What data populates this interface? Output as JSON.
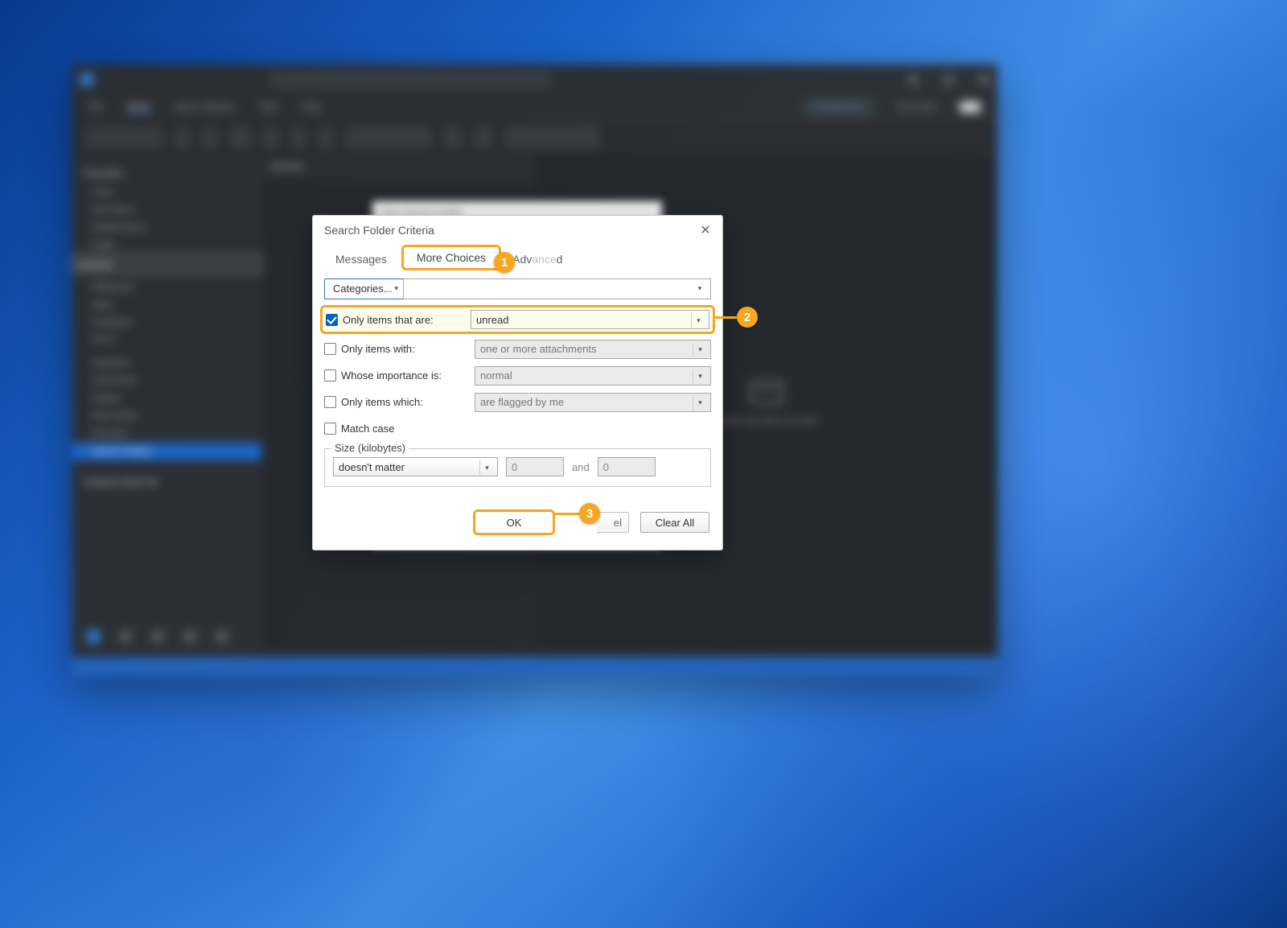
{
  "bg_app": {
    "search_placeholder": "Search",
    "ribbon_tabs": [
      "File",
      "Home",
      "Send / Receive",
      "View",
      "Help"
    ],
    "active_ribbon_tab": "Home",
    "coming_soon": "Coming Soon",
    "try_it_now": "Try it now",
    "new_email": "New Email",
    "unread_read": "Unread/ Read",
    "search_people": "Search People",
    "favorites": "Favorites",
    "fav_items": [
      "Inbox",
      "Sent Items",
      "Deleted Items",
      "Drafts",
      "Archive"
    ],
    "inbox_folders": [
      "AliExpress",
      "eBay",
      "Facebook",
      "IFTTT"
    ],
    "more_folders": [
      "Important",
      "Junk Email",
      "Outbox",
      "RSS Feeds",
      "Snoozed",
      "Search Folders"
    ],
    "data_file": "Outlook Data File",
    "list_header": "Archive",
    "reading_prompt": "Select an item to read",
    "under_dialog_title": "New Search Folder"
  },
  "dialog": {
    "title": "Search Folder Criteria",
    "tabs": {
      "messages": "Messages",
      "more_choices": "More Choices",
      "advanced": "Advanced"
    },
    "categories_btn": "Categories...",
    "rows": {
      "items_that_are": {
        "label": "Only items that are:",
        "checked": true,
        "value": "unread"
      },
      "items_with": {
        "label": "Only items with:",
        "checked": false,
        "value": "one or more attachments"
      },
      "importance": {
        "label": "Whose importance is:",
        "checked": false,
        "value": "normal"
      },
      "items_which": {
        "label": "Only items which:",
        "checked": false,
        "value": "are flagged by me"
      },
      "match_case": {
        "label": "Match case",
        "checked": false
      }
    },
    "size": {
      "legend": "Size (kilobytes)",
      "mode": "doesn't matter",
      "and": "and",
      "from": "0",
      "to": "0"
    },
    "buttons": {
      "ok": "OK",
      "cancel": "el",
      "clear_all": "Clear All"
    }
  },
  "annotations": {
    "1": "1",
    "2": "2",
    "3": "3"
  }
}
